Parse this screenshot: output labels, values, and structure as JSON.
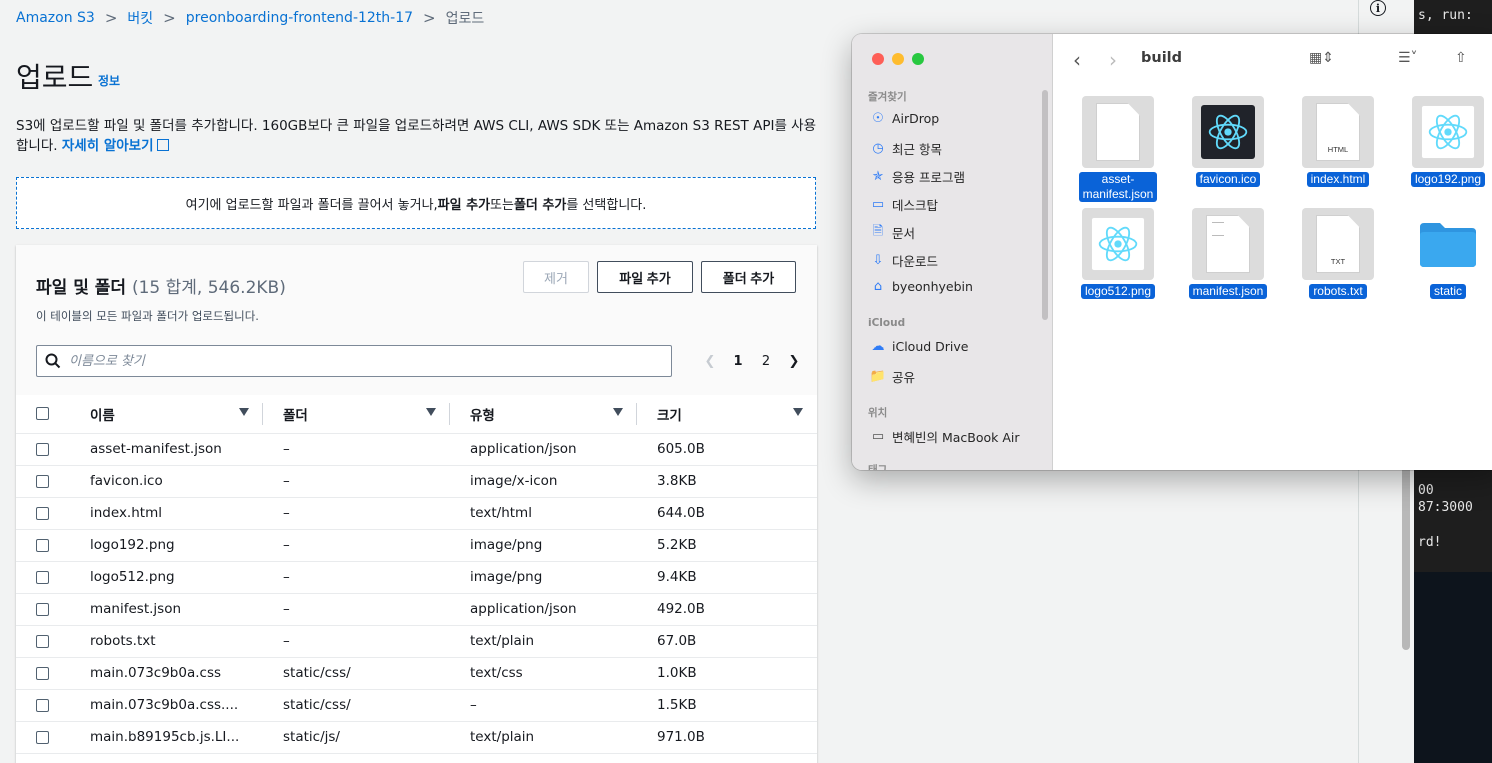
{
  "breadcrumb": {
    "items": [
      "Amazon S3",
      "버킷",
      "preonboarding-frontend-12th-17"
    ],
    "current": "업로드"
  },
  "page": {
    "title": "업로드",
    "info_link": "정보",
    "description": "S3에 업로드할 파일 및 폴더를 추가합니다. 160GB보다 큰 파일을 업로드하려면 AWS CLI, AWS SDK 또는 Amazon S3 REST API를 사용합니다.",
    "learn_more": "자세히 알아보기"
  },
  "dropzone": {
    "prefix": "여기에 업로드할 파일과 폴더를 끌어서 놓거나, ",
    "add_files": "파일 추가",
    "or": " 또는 ",
    "add_folder": "폴더 추가",
    "suffix": "를 선택합니다."
  },
  "files_panel": {
    "title": "파일 및 폴더",
    "count": "(15 합계, 546.2KB)",
    "subtitle": "이 테이블의 모든 파일과 폴더가 업로드됩니다.",
    "remove_label": "제거",
    "add_files_label": "파일 추가",
    "add_folder_label": "폴더 추가",
    "search_placeholder": "이름으로 찾기",
    "pages": [
      "1",
      "2"
    ],
    "current_page": "1",
    "columns": [
      "이름",
      "폴더",
      "유형",
      "크기"
    ],
    "rows": [
      [
        "asset-manifest.json",
        "–",
        "application/json",
        "605.0B"
      ],
      [
        "favicon.ico",
        "–",
        "image/x-icon",
        "3.8KB"
      ],
      [
        "index.html",
        "–",
        "text/html",
        "644.0B"
      ],
      [
        "logo192.png",
        "–",
        "image/png",
        "5.2KB"
      ],
      [
        "logo512.png",
        "–",
        "image/png",
        "9.4KB"
      ],
      [
        "manifest.json",
        "–",
        "application/json",
        "492.0B"
      ],
      [
        "robots.txt",
        "–",
        "text/plain",
        "67.0B"
      ],
      [
        "main.073c9b0a.css",
        "static/css/",
        "text/css",
        "1.0KB"
      ],
      [
        "main.073c9b0a.css....",
        "static/css/",
        "–",
        "1.5KB"
      ],
      [
        "main.b89195cb.js.LI...",
        "static/js/",
        "text/plain",
        "971.0B"
      ]
    ]
  },
  "terminal": {
    "lines": [
      "s, run:",
      "00",
      "87:3000",
      "rd!"
    ]
  },
  "finder": {
    "title": "build",
    "sections": {
      "favorites": "즐겨찾기",
      "icloud": "iCloud",
      "locations": "위치",
      "tags": "태그"
    },
    "favorites": [
      {
        "label": "AirDrop",
        "icon": "airdrop-icon"
      },
      {
        "label": "최근 항목",
        "icon": "clock-icon"
      },
      {
        "label": "응용 프로그램",
        "icon": "applications-icon"
      },
      {
        "label": "데스크탑",
        "icon": "desktop-icon"
      },
      {
        "label": "문서",
        "icon": "document-icon"
      },
      {
        "label": "다운로드",
        "icon": "download-icon"
      },
      {
        "label": "byeonhyebin",
        "icon": "home-icon"
      }
    ],
    "icloud_items": [
      {
        "label": "iCloud Drive",
        "icon": "cloud-icon"
      },
      {
        "label": "공유",
        "icon": "shared-folder-icon"
      }
    ],
    "locations_items": [
      {
        "label": "변혜빈의 MacBook Air",
        "icon": "laptop-icon"
      }
    ],
    "files": [
      {
        "name": "asset-\nmanifest.json",
        "kind": "doc",
        "tag": ""
      },
      {
        "name": "favicon.ico",
        "kind": "react-dark",
        "tag": ""
      },
      {
        "name": "index.html",
        "kind": "doc",
        "tag": "HTML"
      },
      {
        "name": "logo192.png",
        "kind": "react-light",
        "tag": ""
      },
      {
        "name": "logo512.png",
        "kind": "react-light",
        "tag": ""
      },
      {
        "name": "manifest.json",
        "kind": "doc-lines",
        "tag": ""
      },
      {
        "name": "robots.txt",
        "kind": "doc",
        "tag": "TXT"
      },
      {
        "name": "static",
        "kind": "folder",
        "tag": ""
      }
    ]
  },
  "colors": {
    "link": "#0972d3",
    "finder_selection": "#0a63d8",
    "react_cyan": "#61dafb",
    "folder_blue": "#3aa8ef"
  }
}
